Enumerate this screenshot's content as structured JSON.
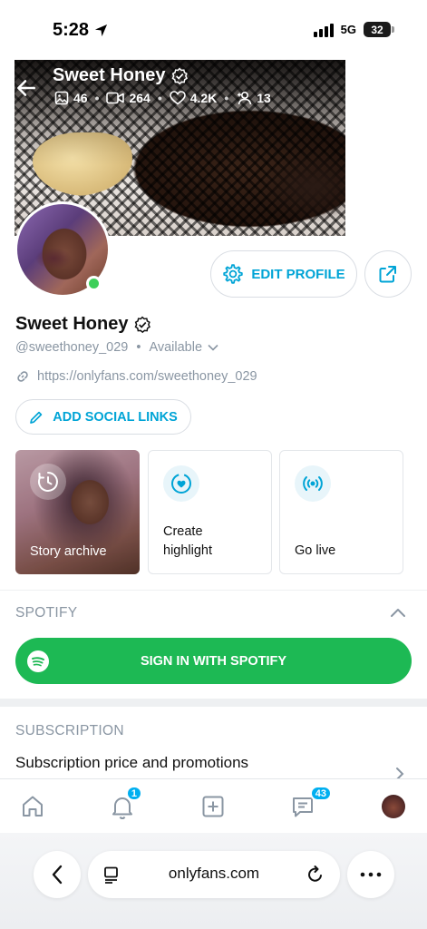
{
  "status_bar": {
    "time": "5:28",
    "network": "5G",
    "battery": "32"
  },
  "header": {
    "name": "Sweet Honey",
    "stats": {
      "photos": "46",
      "videos": "264",
      "likes": "4.2K",
      "fans": "13"
    }
  },
  "profile": {
    "name": "Sweet Honey",
    "handle": "@sweethoney_029",
    "availability": "Available",
    "link": "https://onlyfans.com/sweethoney_029",
    "edit_label": "EDIT PROFILE",
    "social_label": "ADD SOCIAL LINKS"
  },
  "cards": [
    {
      "label": "Story archive"
    },
    {
      "label": "Create\nhighlight"
    },
    {
      "label": "Go live"
    }
  ],
  "spotify": {
    "title": "SPOTIFY",
    "button": "SIGN IN WITH SPOTIFY"
  },
  "subscription": {
    "title": "SUBSCRIPTION",
    "row": "Subscription price and promotions"
  },
  "nav": {
    "notifications_badge": "1",
    "messages_badge": "43"
  },
  "browser": {
    "url": "onlyfans.com"
  },
  "colors": {
    "accent": "#00a4d6",
    "spotify_green": "#1db954",
    "online": "#3ecf5a",
    "badge": "#00aff0"
  }
}
